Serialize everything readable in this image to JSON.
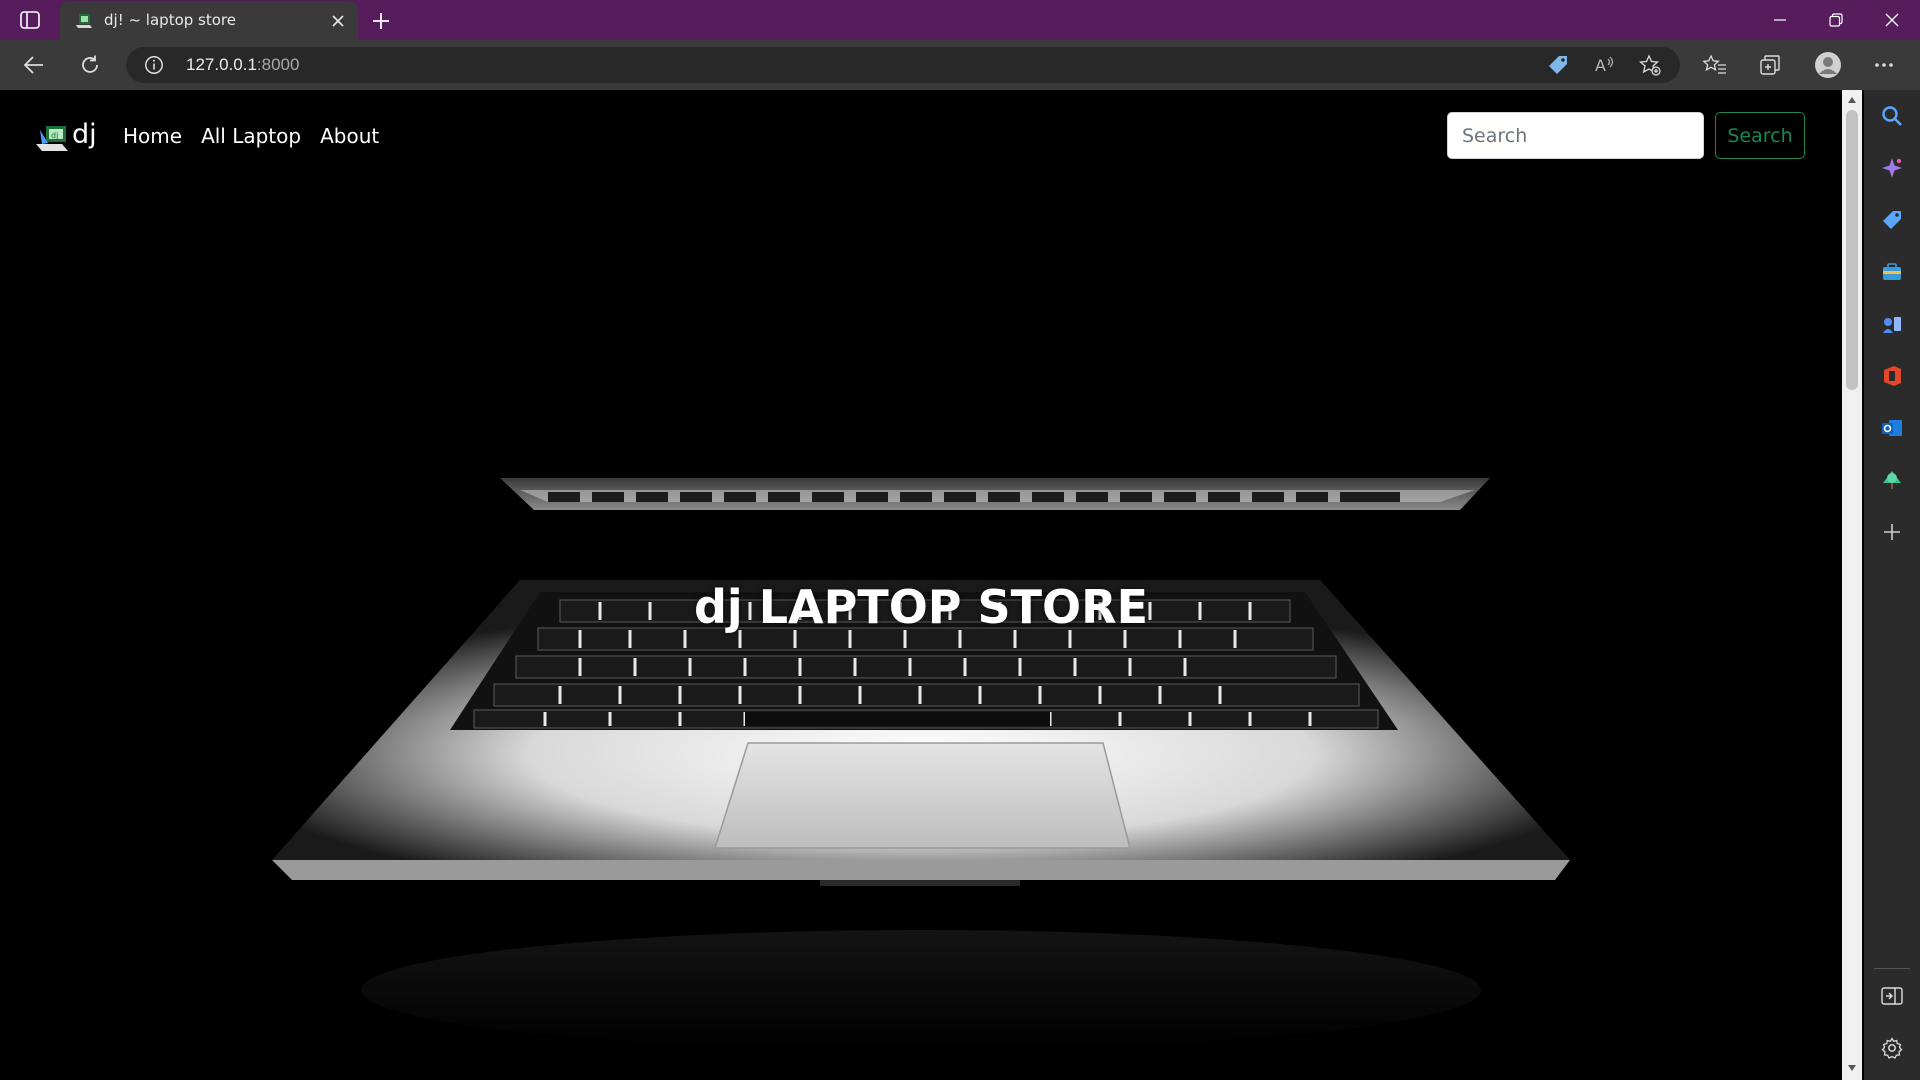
{
  "browser": {
    "tab": {
      "title": "dj! ~ laptop store"
    },
    "address": {
      "host": "127.0.0.1",
      "port": ":8000"
    }
  },
  "site": {
    "brand": "dj",
    "nav": [
      {
        "label": "Home"
      },
      {
        "label": "All Laptop"
      },
      {
        "label": "About"
      }
    ],
    "search": {
      "placeholder": "Search",
      "button_label": "Search"
    }
  },
  "hero": {
    "title": "dj LAPTOP STORE"
  },
  "colors": {
    "titlebar": "#561c5c",
    "toolbar": "#3a3a3a",
    "search_button": "#198754",
    "page_background": "#000000"
  }
}
